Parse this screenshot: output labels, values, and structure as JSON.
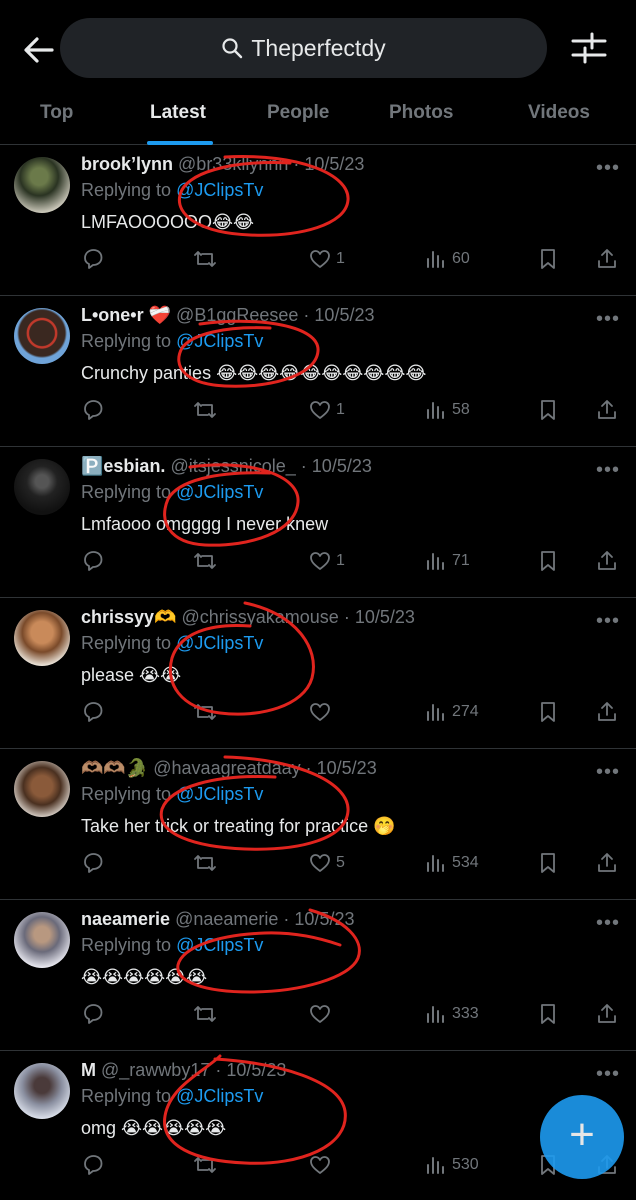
{
  "search": {
    "query": "Theperfectdy"
  },
  "tabs": [
    {
      "label": "Top"
    },
    {
      "label": "Latest"
    },
    {
      "label": "People"
    },
    {
      "label": "Photos"
    },
    {
      "label": "Videos"
    }
  ],
  "posts": [
    {
      "name": "brook’lynn",
      "handle": "@br33kllynnn",
      "date": "· 10/5/23",
      "replying_prefix": "Replying to",
      "replying_to": "@JClipsTv",
      "body": "LMFAOOOOOO😂😂",
      "replies": "",
      "reposts": "",
      "likes": "1",
      "views": "60"
    },
    {
      "name": "L•one•r ❤️‍🩹",
      "handle": "@B1ggReesee",
      "date": "· 10/5/23",
      "replying_prefix": "Replying to",
      "replying_to": "@JClipsTv",
      "body": "Crunchy panties 😂😂😂😂😂😂😂😂😂😂",
      "replies": "",
      "reposts": "",
      "likes": "1",
      "views": "58"
    },
    {
      "name": "🅿️esbian.",
      "handle": "@itsjessnicole_",
      "date": "· 10/5/23",
      "replying_prefix": "Replying to",
      "replying_to": "@JClipsTv",
      "body": "Lmfaooo omgggg I never knew",
      "replies": "",
      "reposts": "",
      "likes": "1",
      "views": "71"
    },
    {
      "name": "chrissyy🫶",
      "handle": "@chrissyakamouse",
      "date": "· 10/5/23",
      "replying_prefix": "Replying to",
      "replying_to": "@JClipsTv",
      "body": "please 😭😭",
      "replies": "",
      "reposts": "",
      "likes": "",
      "views": "274"
    },
    {
      "name": "🫶🏽🫶🏽🐊",
      "handle": "@havaagreatdaay",
      "date": "· 10/5/23",
      "replying_prefix": "Replying to",
      "replying_to": "@JClipsTv",
      "body": "Take her trick or treating for practice 🤭",
      "replies": "",
      "reposts": "",
      "likes": "5",
      "views": "534"
    },
    {
      "name": "naeamerie",
      "handle": "@naeamerie",
      "date": "· 10/5/23",
      "replying_prefix": "Replying to",
      "replying_to": "@JClipsTv",
      "body": "😭😭😭😭😭😭",
      "replies": "",
      "reposts": "",
      "likes": "",
      "views": "333"
    },
    {
      "name": "M",
      "handle": "@_rawwby17",
      "date": "· 10/5/23",
      "replying_prefix": "Replying to",
      "replying_to": "@JClipsTv",
      "body": "omg 😭😭😭😭😭",
      "replies": "",
      "reposts": "",
      "likes": "",
      "views": "530"
    }
  ],
  "colors": {
    "accent": "#1d9bf0",
    "muted": "#71767b",
    "annotation": "#e0241e"
  },
  "icons": [
    "back-arrow-icon",
    "search-icon",
    "filter-sliders-icon",
    "reply-icon",
    "repost-icon",
    "like-icon",
    "views-icon",
    "bookmark-icon",
    "share-icon",
    "more-icon",
    "compose-plus-icon"
  ],
  "fab": {
    "label": "+"
  }
}
